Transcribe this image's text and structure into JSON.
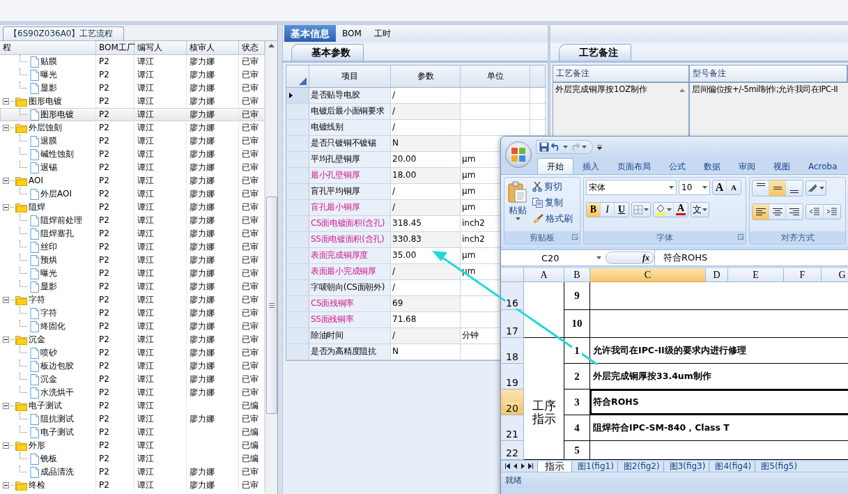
{
  "left_panel": {
    "tab": "【6S90Z036A0】工艺流程",
    "columns": [
      "程",
      "BOM工厂",
      "编写人",
      "核审人",
      "状态"
    ],
    "tree": [
      {
        "children": [
          {
            "kind": "file",
            "label": "贴膜",
            "bom": "P2",
            "writer": "谭江",
            "reviewer": "廖力娜",
            "status": "已审",
            "selected": false
          },
          {
            "kind": "file",
            "label": "曝光",
            "bom": "P2",
            "writer": "谭江",
            "reviewer": "廖力娜",
            "status": "已审",
            "selected": false
          },
          {
            "kind": "file",
            "label": "显影",
            "bom": "P2",
            "writer": "谭江",
            "reviewer": "廖力娜",
            "status": "已审",
            "selected": false
          }
        ]
      },
      {
        "kind": "folder",
        "expanded": true,
        "label": "图形电镀",
        "bom": "P2",
        "writer": "谭江",
        "reviewer": "廖力娜",
        "status": "已审",
        "selected": false,
        "children": [
          {
            "kind": "file",
            "label": "图形电镀",
            "bom": "P2",
            "writer": "谭江",
            "reviewer": "廖力娜",
            "status": "已审",
            "selected": true
          }
        ]
      },
      {
        "kind": "folder",
        "expanded": true,
        "label": "外层蚀刻",
        "bom": "P2",
        "writer": "谭江",
        "reviewer": "廖力娜",
        "status": "已审",
        "selected": false,
        "children": [
          {
            "kind": "file",
            "label": "退膜",
            "bom": "P2",
            "writer": "谭江",
            "reviewer": "廖力娜",
            "status": "已审",
            "selected": false
          },
          {
            "kind": "file",
            "label": "碱性蚀刻",
            "bom": "P2",
            "writer": "谭江",
            "reviewer": "廖力娜",
            "status": "已审",
            "selected": false
          },
          {
            "kind": "file",
            "label": "退锡",
            "bom": "P2",
            "writer": "谭江",
            "reviewer": "廖力娜",
            "status": "已审",
            "selected": false
          }
        ]
      },
      {
        "kind": "folder",
        "expanded": true,
        "label": "AOI",
        "bom": "P2",
        "writer": "谭江",
        "reviewer": "廖力娜",
        "status": "已审",
        "selected": false,
        "children": [
          {
            "kind": "file",
            "label": "外层AOI",
            "bom": "P2",
            "writer": "谭江",
            "reviewer": "廖力娜",
            "status": "已审",
            "selected": false
          }
        ]
      },
      {
        "kind": "folder",
        "expanded": true,
        "label": "阻焊",
        "bom": "P2",
        "writer": "谭江",
        "reviewer": "廖力娜",
        "status": "已审",
        "selected": false,
        "children": [
          {
            "kind": "file",
            "label": "阻焊前处理",
            "bom": "P2",
            "writer": "谭江",
            "reviewer": "廖力娜",
            "status": "已审",
            "selected": false
          },
          {
            "kind": "file",
            "label": "阻焊塞孔",
            "bom": "P2",
            "writer": "谭江",
            "reviewer": "廖力娜",
            "status": "已审",
            "selected": false
          },
          {
            "kind": "file",
            "label": "丝印",
            "bom": "P2",
            "writer": "谭江",
            "reviewer": "廖力娜",
            "status": "已审",
            "selected": false
          },
          {
            "kind": "file",
            "label": "预烘",
            "bom": "P2",
            "writer": "谭江",
            "reviewer": "廖力娜",
            "status": "已审",
            "selected": false
          },
          {
            "kind": "file",
            "label": "曝光",
            "bom": "P2",
            "writer": "谭江",
            "reviewer": "廖力娜",
            "status": "已审",
            "selected": false
          },
          {
            "kind": "file",
            "label": "显影",
            "bom": "P2",
            "writer": "谭江",
            "reviewer": "廖力娜",
            "status": "已审",
            "selected": false
          }
        ]
      },
      {
        "kind": "folder",
        "expanded": true,
        "label": "字符",
        "bom": "P2",
        "writer": "谭江",
        "reviewer": "廖力娜",
        "status": "已审",
        "selected": false,
        "children": [
          {
            "kind": "file",
            "label": "字符",
            "bom": "P2",
            "writer": "谭江",
            "reviewer": "廖力娜",
            "status": "已审",
            "selected": false
          },
          {
            "kind": "file",
            "label": "终固化",
            "bom": "P2",
            "writer": "谭江",
            "reviewer": "廖力娜",
            "status": "已审",
            "selected": false
          }
        ]
      },
      {
        "kind": "folder",
        "expanded": true,
        "label": "沉金",
        "bom": "P2",
        "writer": "谭江",
        "reviewer": "廖力娜",
        "status": "已审",
        "selected": false,
        "children": [
          {
            "kind": "file",
            "label": "喷砂",
            "bom": "P2",
            "writer": "谭江",
            "reviewer": "廖力娜",
            "status": "已审",
            "selected": false
          },
          {
            "kind": "file",
            "label": "板边包胶",
            "bom": "P2",
            "writer": "谭江",
            "reviewer": "廖力娜",
            "status": "已审",
            "selected": false
          },
          {
            "kind": "file",
            "label": "沉金",
            "bom": "P2",
            "writer": "谭江",
            "reviewer": "廖力娜",
            "status": "已审",
            "selected": false
          },
          {
            "kind": "file",
            "label": "水洗烘干",
            "bom": "P2",
            "writer": "谭江",
            "reviewer": "廖力娜",
            "status": "已审",
            "selected": false
          }
        ]
      },
      {
        "kind": "folder",
        "expanded": true,
        "label": "电子测试",
        "bom": "P2",
        "writer": "谭江",
        "status": "已编",
        "selected": false,
        "children": [
          {
            "kind": "file",
            "label": "阻抗测试",
            "bom": "P2",
            "writer": "谭江",
            "reviewer": "廖力娜",
            "status": "已审",
            "selected": false
          },
          {
            "kind": "file",
            "label": "电子测试",
            "bom": "P2",
            "writer": "谭江",
            "status": "已编",
            "selected": false
          }
        ]
      },
      {
        "kind": "folder",
        "expanded": true,
        "label": "外形",
        "bom": "P2",
        "writer": "谭江",
        "status": "已编",
        "selected": false,
        "children": [
          {
            "kind": "file",
            "label": "铣板",
            "bom": "P2",
            "writer": "谭江",
            "status": "已编",
            "selected": false
          },
          {
            "kind": "file",
            "label": "成品清洗",
            "bom": "P2",
            "writer": "谭江",
            "reviewer": "廖力娜",
            "status": "已审",
            "selected": false
          }
        ]
      },
      {
        "kind": "folder",
        "expanded": true,
        "label": "终检",
        "bom": "P2",
        "writer": "谭江",
        "reviewer": "廖力娜",
        "status": "已审",
        "selected": false
      }
    ]
  },
  "middle_panel": {
    "tabs": [
      {
        "label": "基本信息",
        "selected": true
      },
      {
        "label": "BOM",
        "selected": false
      },
      {
        "label": "工时",
        "selected": false
      }
    ],
    "subtab": "基本参数",
    "columns": [
      "项目",
      "参数",
      "单位"
    ],
    "rows": [
      {
        "item": "是否贴导电胶",
        "value": "/",
        "highlighted": false,
        "selected": true
      },
      {
        "item": "电镀后最小面铜要求",
        "value": "/",
        "highlighted": false,
        "selected": false
      },
      {
        "item": "电镀线别",
        "value": "/",
        "highlighted": false,
        "selected": false
      },
      {
        "item": "是否只镀铜不镀锡",
        "value": "N",
        "highlighted": false,
        "selected": false
      },
      {
        "item": "平均孔壁铜厚",
        "value": "20.00",
        "unit": "μm",
        "highlighted": false,
        "selected": false
      },
      {
        "item": "最小孔壁铜厚",
        "value": "18.00",
        "unit": "μm",
        "highlighted": true,
        "selected": false
      },
      {
        "item": "盲孔平均铜厚",
        "value": "/",
        "unit": "μm",
        "highlighted": false,
        "selected": false
      },
      {
        "item": "盲孔最小铜厚",
        "value": "/",
        "unit": "μm",
        "highlighted": true,
        "selected": false
      },
      {
        "item": "CS面电镀面积(含孔)",
        "value": "318.45",
        "unit": "inch2",
        "highlighted": true,
        "selected": false
      },
      {
        "item": "SS面电镀面积(含孔)",
        "value": "330.83",
        "unit": "inch2",
        "highlighted": true,
        "selected": false
      },
      {
        "item": "表面完成铜厚度",
        "value": "35.00",
        "unit": "μm",
        "highlighted": true,
        "selected": false
      },
      {
        "item": "表面最小完成铜厚",
        "value": "/",
        "unit": "μm",
        "highlighted": true,
        "selected": false
      },
      {
        "item": "字唛朝向(CS面朝外)",
        "value": "/",
        "highlighted": false,
        "selected": false
      },
      {
        "item": "CS面残铜率",
        "value": "69",
        "highlighted": true,
        "selected": false
      },
      {
        "item": "SS面残铜率",
        "value": "71.68",
        "highlighted": true,
        "selected": false
      },
      {
        "item": "除油时间",
        "value": "/",
        "unit": "分钟",
        "highlighted": false,
        "selected": false
      },
      {
        "item": "是否为高精度阻抗",
        "value": "N",
        "highlighted": false,
        "selected": false
      }
    ]
  },
  "right_panel": {
    "subtab": "工艺备注",
    "columns": [
      "工艺备注",
      "型号备注"
    ],
    "rows": [
      {
        "process_note": "外层完成铜厚按1OZ制作",
        "model_note": "层间偏位按+/-5mil制作;允许我司在IPC-II"
      }
    ]
  },
  "excel": {
    "ribbon_tabs": [
      {
        "label": "开始",
        "selected": true
      },
      {
        "label": "插入",
        "selected": false
      },
      {
        "label": "页面布局",
        "selected": false
      },
      {
        "label": "公式",
        "selected": false
      },
      {
        "label": "数据",
        "selected": false
      },
      {
        "label": "审阅",
        "selected": false
      },
      {
        "label": "视图",
        "selected": false
      },
      {
        "label": "Acroba",
        "selected": false
      }
    ],
    "clipboard": {
      "paste": "粘贴",
      "cut": "剪切",
      "copy": "复制",
      "format_painter": "格式刷",
      "group": "剪贴板"
    },
    "font": {
      "name": "宋体",
      "size": "10",
      "grow": "A",
      "shrink": "A",
      "bold_label": "B",
      "italic_label": "I",
      "underline_label": "U",
      "color_label": "A",
      "phonetic_label": "文",
      "group": "字体",
      "bold": true,
      "italic": false,
      "underline": false
    },
    "alignment": {
      "group": "对齐方式",
      "vertical": [
        {
          "kind": "top",
          "selected": false
        },
        {
          "kind": "middle",
          "selected": true
        },
        {
          "kind": "bottom",
          "selected": false
        }
      ],
      "horizontal": [
        {
          "kind": "left",
          "selected": true
        },
        {
          "kind": "center",
          "selected": false
        },
        {
          "kind": "right",
          "selected": false
        }
      ]
    },
    "formula_bar": {
      "cell": "C20",
      "function_label": "fx",
      "formula": "符合ROHS"
    },
    "columns": [
      {
        "label": "A",
        "selected": false
      },
      {
        "label": "B",
        "selected": false
      },
      {
        "label": "C",
        "selected": true
      },
      {
        "label": "D",
        "selected": false
      },
      {
        "label": "E",
        "selected": false
      },
      {
        "label": "F",
        "selected": false
      },
      {
        "label": "G",
        "selected": false
      }
    ],
    "section_label": "工序指示",
    "rows": [
      {
        "number": "16",
        "b": "9",
        "selected": false
      },
      {
        "number": "17",
        "b": "10",
        "selected": false
      },
      {
        "number": "18",
        "b": "1",
        "c": "允许我司在IPC-II级的要求内进行修理",
        "selected": false
      },
      {
        "number": "19",
        "b": "2",
        "c": "外层完成铜厚按33.4um制作",
        "selected": false
      },
      {
        "number": "20",
        "b": "3",
        "c": "符合ROHS",
        "selected": true
      },
      {
        "number": "21",
        "b": "4",
        "c": "阻焊符合IPC-SM-840，Class T",
        "selected": false
      },
      {
        "number": "22",
        "b": "5",
        "selected": false
      }
    ],
    "sheet_tabs": [
      {
        "label": "指示",
        "selected": true
      },
      {
        "label": "图1(fig1)",
        "selected": false
      },
      {
        "label": "图2(fig2)",
        "selected": false
      },
      {
        "label": "图3(fig3)",
        "selected": false
      },
      {
        "label": "图4(fig4)",
        "selected": false
      },
      {
        "label": "图5(fig5)",
        "selected": false
      }
    ],
    "status": "就绪"
  }
}
